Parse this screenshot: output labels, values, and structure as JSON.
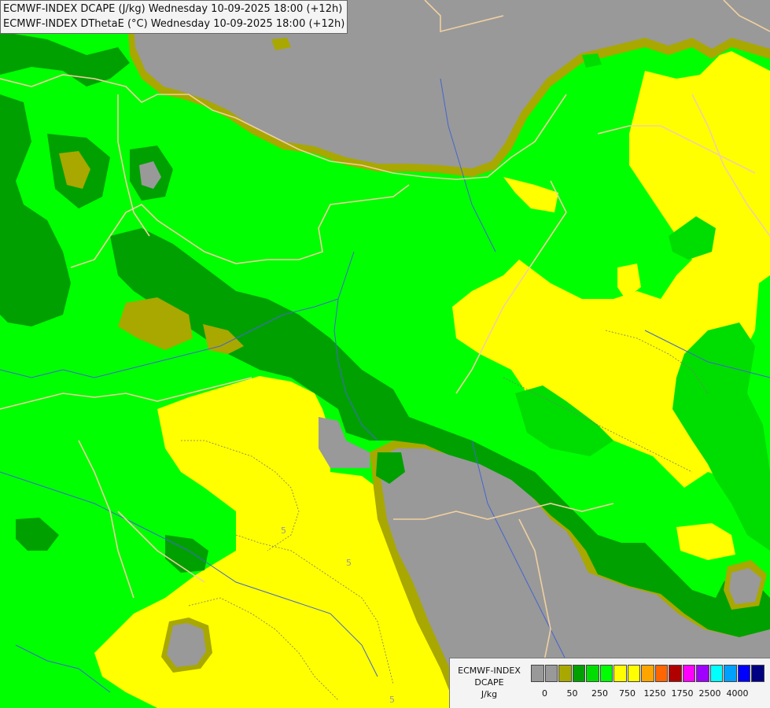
{
  "title": {
    "line1": "ECMWF-INDEX DCAPE (J/kg) Wednesday 10-09-2025 18:00 (+12h)",
    "line2": "ECMWF-INDEX DThetaE (°C) Wednesday 10-09-2025 18:00 (+12h)"
  },
  "map": {
    "contour_labels": [
      "5",
      "5",
      "5"
    ],
    "colors": {
      "no_data": "#999999",
      "olive": "#a8a800",
      "dark_green": "#00a000",
      "green": "#00dd00",
      "light_green": "#00ff00",
      "yellow": "#ffff00",
      "river": "#4466cc",
      "border": "#f0d0a0"
    }
  },
  "legend": {
    "name": "ECMWF-INDEX",
    "param": "DCAPE",
    "unit": "J/kg",
    "swatches": [
      "#999999",
      "#999999",
      "#a8a800",
      "#00a000",
      "#00dd00",
      "#00ff00",
      "#ffff00",
      "#ffff00",
      "#ffa500",
      "#ff6600",
      "#b00000",
      "#ff00ff",
      "#a000ff",
      "#00ffff",
      "#00a0ff",
      "#0000ff",
      "#000080"
    ],
    "tick_labels": [
      "0",
      "50",
      "250",
      "750",
      "1250",
      "1750",
      "2500",
      "4000"
    ]
  }
}
